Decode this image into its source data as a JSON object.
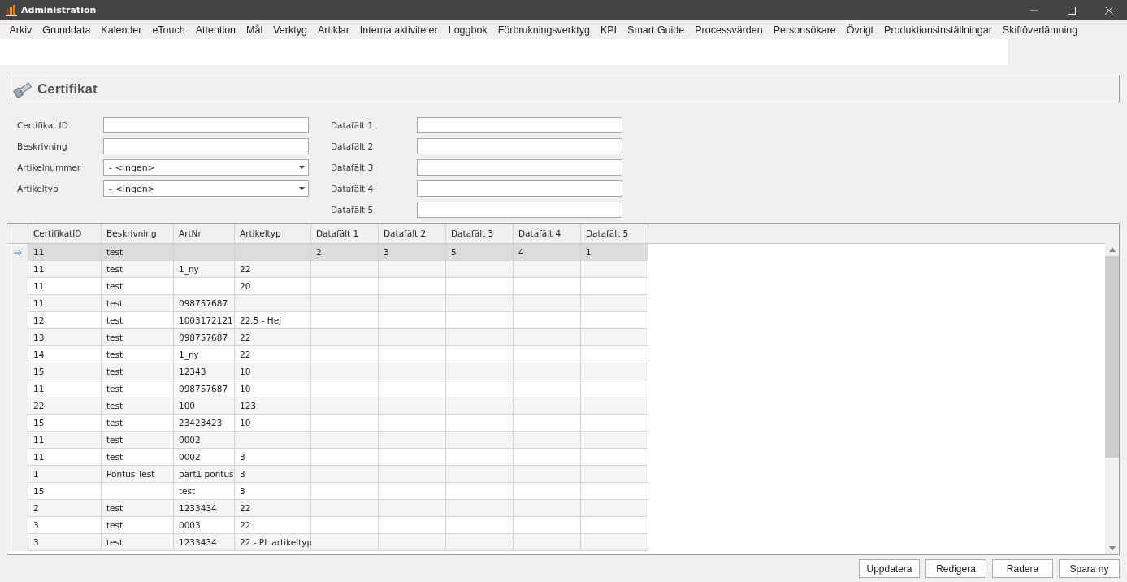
{
  "window": {
    "title": "Administration"
  },
  "menu": [
    "Arkiv",
    "Grunddata",
    "Kalender",
    "eTouch",
    "Attention",
    "Mål",
    "Verktyg",
    "Artiklar",
    "Interna aktiviteter",
    "Loggbok",
    "Förbrukningsverktyg",
    "KPI",
    "Smart Guide",
    "Processvärden",
    "Personsökare",
    "Övrigt",
    "Produktionsinställningar",
    "Skiftöverlämning"
  ],
  "panel": {
    "title": "Certifikat"
  },
  "form_left": [
    {
      "label": "Certifikat ID",
      "kind": "text"
    },
    {
      "label": "Beskrivning",
      "kind": "text"
    },
    {
      "label": "Artikelnummer",
      "kind": "dropdown",
      "value": "- <Ingen>"
    },
    {
      "label": "Artikeltyp",
      "kind": "dropdown",
      "value": "- <Ingen>"
    }
  ],
  "form_right": [
    {
      "label": "Datafält 1",
      "kind": "text"
    },
    {
      "label": "Datafält 2",
      "kind": "text"
    },
    {
      "label": "Datafält 3",
      "kind": "text"
    },
    {
      "label": "Datafält 4",
      "kind": "text"
    },
    {
      "label": "Datafält 5",
      "kind": "text"
    }
  ],
  "table": {
    "columns": [
      "CertifikatID",
      "Beskrivning",
      "ArtNr",
      "Artikeltyp",
      "Datafält 1",
      "Datafält 2",
      "Datafält 3",
      "Datafält 4",
      "Datafält 5"
    ],
    "rows": [
      {
        "selected": true,
        "cells": [
          "11",
          "test",
          "",
          "",
          "2",
          "3",
          "5",
          "4",
          "1"
        ]
      },
      {
        "selected": false,
        "cells": [
          "11",
          "test",
          "1_ny",
          "22",
          "",
          "",
          "",
          "",
          ""
        ]
      },
      {
        "selected": false,
        "cells": [
          "11",
          "test",
          "",
          "20",
          "",
          "",
          "",
          "",
          ""
        ]
      },
      {
        "selected": false,
        "cells": [
          "11",
          "test",
          "098757687",
          "",
          "",
          "",
          "",
          "",
          ""
        ]
      },
      {
        "selected": false,
        "cells": [
          "12",
          "test",
          "1003172121",
          "22,5 - Hej",
          "",
          "",
          "",
          "",
          ""
        ]
      },
      {
        "selected": false,
        "cells": [
          "13",
          "test",
          "098757687",
          "22",
          "",
          "",
          "",
          "",
          ""
        ]
      },
      {
        "selected": false,
        "cells": [
          "14",
          "test",
          "1_ny",
          "22",
          "",
          "",
          "",
          "",
          ""
        ]
      },
      {
        "selected": false,
        "cells": [
          "15",
          "test",
          "12343",
          "10",
          "",
          "",
          "",
          "",
          ""
        ]
      },
      {
        "selected": false,
        "cells": [
          "11",
          "test",
          "098757687",
          "10",
          "",
          "",
          "",
          "",
          ""
        ]
      },
      {
        "selected": false,
        "cells": [
          "22",
          "test",
          "100",
          "123",
          "",
          "",
          "",
          "",
          ""
        ]
      },
      {
        "selected": false,
        "cells": [
          "15",
          "test",
          "23423423",
          "10",
          "",
          "",
          "",
          "",
          ""
        ]
      },
      {
        "selected": false,
        "cells": [
          "11",
          "test",
          "0002",
          "",
          "",
          "",
          "",
          "",
          ""
        ]
      },
      {
        "selected": false,
        "cells": [
          "11",
          "test",
          "0002",
          "3",
          "",
          "",
          "",
          "",
          ""
        ]
      },
      {
        "selected": false,
        "cells": [
          "1",
          "Pontus Test",
          "part1 pontus",
          "3",
          "",
          "",
          "",
          "",
          ""
        ]
      },
      {
        "selected": false,
        "cells": [
          "15",
          "",
          "test",
          "3",
          "",
          "",
          "",
          "",
          ""
        ]
      },
      {
        "selected": false,
        "cells": [
          "2",
          "test",
          "1233434",
          "22",
          "",
          "",
          "",
          "",
          ""
        ]
      },
      {
        "selected": false,
        "cells": [
          "3",
          "test",
          "0003",
          "22",
          "",
          "",
          "",
          "",
          ""
        ]
      },
      {
        "selected": false,
        "cells": [
          "3",
          "test",
          "1233434",
          "22 - PL artikeltyp",
          "",
          "",
          "",
          "",
          ""
        ]
      }
    ]
  },
  "buttons": [
    "Uppdatera",
    "Redigera",
    "Radera",
    "Spara ny"
  ]
}
